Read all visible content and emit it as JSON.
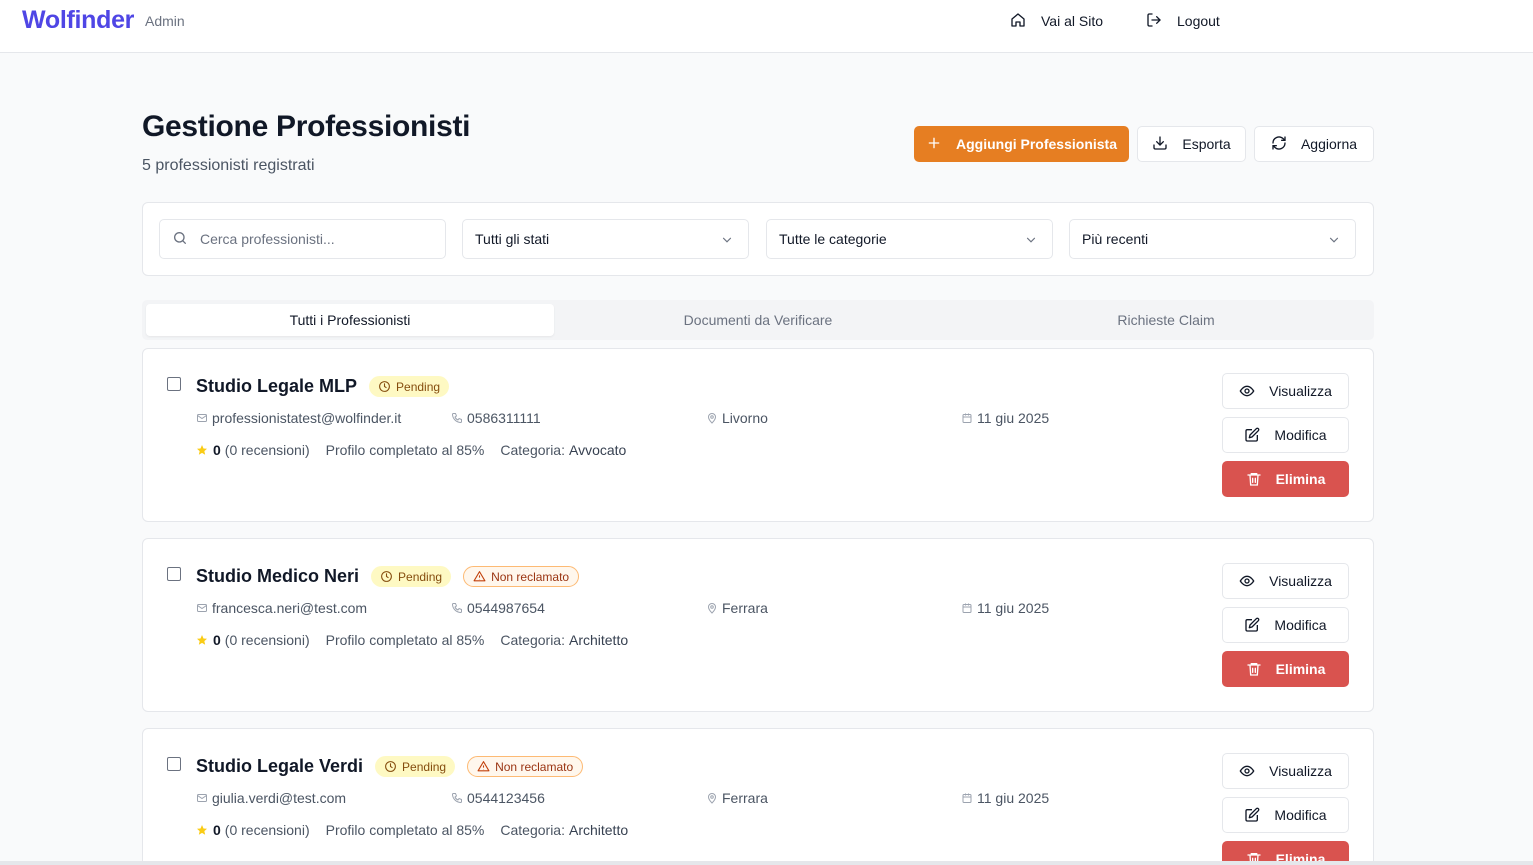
{
  "header": {
    "brand": "Wolfinder",
    "brand_sub": "Admin",
    "nav_site": "Vai al Sito",
    "nav_logout": "Logout"
  },
  "page": {
    "title": "Gestione Professionisti",
    "subtitle": "5 professionisti registrati"
  },
  "actions": {
    "add": "Aggiungi Professionista",
    "export": "Esporta",
    "refresh": "Aggiorna"
  },
  "filters": {
    "search_placeholder": "Cerca professionisti...",
    "status": "Tutti gli stati",
    "category": "Tutte le categorie",
    "sort": "Più recenti"
  },
  "tabs": [
    {
      "label": "Tutti i Professionisti",
      "active": true
    },
    {
      "label": "Documenti da Verificare",
      "active": false
    },
    {
      "label": "Richieste Claim",
      "active": false
    }
  ],
  "labels": {
    "view": "Visualizza",
    "edit": "Modifica",
    "delete": "Elimina",
    "category_prefix": "Categoria:"
  },
  "professionals": [
    {
      "name": "Studio Legale MLP",
      "status": "Pending",
      "claim": "",
      "email": "professionistatest@wolfinder.it",
      "phone": "0586311111",
      "city": "Livorno",
      "date": "11 giu 2025",
      "rating": "0",
      "reviews": "(0 recensioni)",
      "completion": "Profilo completato al 85%",
      "category": "Avvocato"
    },
    {
      "name": "Studio Medico Neri",
      "status": "Pending",
      "claim": "Non reclamato",
      "email": "francesca.neri@test.com",
      "phone": "0544987654",
      "city": "Ferrara",
      "date": "11 giu 2025",
      "rating": "0",
      "reviews": "(0 recensioni)",
      "completion": "Profilo completato al 85%",
      "category": "Architetto"
    },
    {
      "name": "Studio Legale Verdi",
      "status": "Pending",
      "claim": "Non reclamato",
      "email": "giulia.verdi@test.com",
      "phone": "0544123456",
      "city": "Ferrara",
      "date": "11 giu 2025",
      "rating": "0",
      "reviews": "(0 recensioni)",
      "completion": "Profilo completato al 85%",
      "category": "Architetto"
    }
  ],
  "colors": {
    "brand": "#4f46e5",
    "primary_action": "#e67e22",
    "danger": "#d9534f",
    "pending_bg": "#fef9c3",
    "star": "#facc15"
  }
}
